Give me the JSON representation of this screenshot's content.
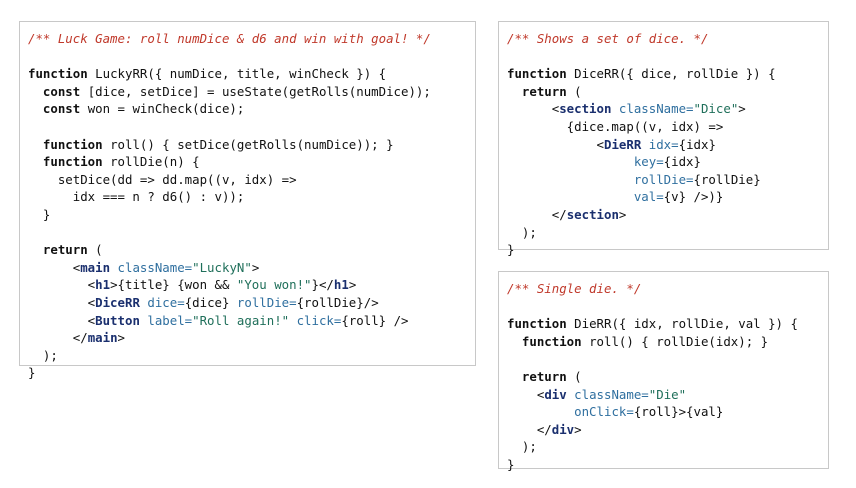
{
  "colors": {
    "comment": "#c0392b",
    "tag": "#1a2f6e",
    "attribute": "#2f6f9f",
    "string": "#1f6f5a",
    "text": "#111111",
    "border": "#c8c8c8"
  },
  "panels": [
    {
      "id": "lucky",
      "lines": [
        [
          [
            "cm",
            "/** Luck Game: roll numDice & d6 and win with goal! */"
          ]
        ],
        [],
        [
          [
            "kw",
            "function"
          ],
          [
            "pl",
            " LuckyRR({ numDice, title, winCheck }) {"
          ]
        ],
        [
          [
            "pl",
            "  "
          ],
          [
            "kw",
            "const"
          ],
          [
            "pl",
            " [dice, setDice] = useState(getRolls(numDice));"
          ]
        ],
        [
          [
            "pl",
            "  "
          ],
          [
            "kw",
            "const"
          ],
          [
            "pl",
            " won = winCheck(dice);"
          ]
        ],
        [],
        [
          [
            "pl",
            "  "
          ],
          [
            "kw",
            "function"
          ],
          [
            "pl",
            " roll() { setDice(getRolls(numDice)); }"
          ]
        ],
        [
          [
            "pl",
            "  "
          ],
          [
            "kw",
            "function"
          ],
          [
            "pl",
            " rollDie(n) {"
          ]
        ],
        [
          [
            "pl",
            "    setDice(dd => dd.map((v, idx) =>"
          ]
        ],
        [
          [
            "pl",
            "      idx === n ? d6() : v));"
          ]
        ],
        [
          [
            "pl",
            "  }"
          ]
        ],
        [],
        [
          [
            "pl",
            "  "
          ],
          [
            "kw",
            "return"
          ],
          [
            "pl",
            " ("
          ]
        ],
        [
          [
            "pl",
            "      <"
          ],
          [
            "tag",
            "main"
          ],
          [
            "pl",
            " "
          ],
          [
            "attr",
            "className="
          ],
          [
            "str",
            "\"LuckyN\""
          ],
          [
            "pl",
            ">"
          ]
        ],
        [
          [
            "pl",
            "        <"
          ],
          [
            "tag",
            "h1"
          ],
          [
            "pl",
            ">{title} {won && "
          ],
          [
            "str",
            "\"You won!\""
          ],
          [
            "pl",
            "}</"
          ],
          [
            "tag",
            "h1"
          ],
          [
            "pl",
            ">"
          ]
        ],
        [
          [
            "pl",
            "        <"
          ],
          [
            "tag",
            "DiceRR"
          ],
          [
            "pl",
            " "
          ],
          [
            "attr",
            "dice="
          ],
          [
            "pl",
            "{dice} "
          ],
          [
            "attr",
            "rollDie="
          ],
          [
            "pl",
            "{rollDie}/>"
          ]
        ],
        [
          [
            "pl",
            "        <"
          ],
          [
            "tag",
            "Button"
          ],
          [
            "pl",
            " "
          ],
          [
            "attr",
            "label="
          ],
          [
            "str",
            "\"Roll again!\""
          ],
          [
            "pl",
            " "
          ],
          [
            "attr",
            "click="
          ],
          [
            "pl",
            "{roll} />"
          ]
        ],
        [
          [
            "pl",
            "      </"
          ],
          [
            "tag",
            "main"
          ],
          [
            "pl",
            ">"
          ]
        ],
        [
          [
            "pl",
            "  );"
          ]
        ],
        [
          [
            "pl",
            "}"
          ]
        ]
      ]
    },
    {
      "id": "dice",
      "lines": [
        [
          [
            "cm",
            "/** Shows a set of dice. */"
          ]
        ],
        [],
        [
          [
            "kw",
            "function"
          ],
          [
            "pl",
            " DiceRR({ dice, rollDie }) {"
          ]
        ],
        [
          [
            "pl",
            "  "
          ],
          [
            "kw",
            "return"
          ],
          [
            "pl",
            " ("
          ]
        ],
        [
          [
            "pl",
            "      <"
          ],
          [
            "tag",
            "section"
          ],
          [
            "pl",
            " "
          ],
          [
            "attr",
            "className="
          ],
          [
            "str",
            "\"Dice\""
          ],
          [
            "pl",
            ">"
          ]
        ],
        [
          [
            "pl",
            "        {dice.map((v, idx) =>"
          ]
        ],
        [
          [
            "pl",
            "            <"
          ],
          [
            "tag",
            "DieRR"
          ],
          [
            "pl",
            " "
          ],
          [
            "attr",
            "idx="
          ],
          [
            "pl",
            "{idx}"
          ]
        ],
        [
          [
            "pl",
            "                 "
          ],
          [
            "attr",
            "key="
          ],
          [
            "pl",
            "{idx}"
          ]
        ],
        [
          [
            "pl",
            "                 "
          ],
          [
            "attr",
            "rollDie="
          ],
          [
            "pl",
            "{rollDie}"
          ]
        ],
        [
          [
            "pl",
            "                 "
          ],
          [
            "attr",
            "val="
          ],
          [
            "pl",
            "{v} />)}"
          ]
        ],
        [
          [
            "pl",
            "      </"
          ],
          [
            "tag",
            "section"
          ],
          [
            "pl",
            ">"
          ]
        ],
        [
          [
            "pl",
            "  );"
          ]
        ],
        [
          [
            "pl",
            "}"
          ]
        ]
      ]
    },
    {
      "id": "die",
      "lines": [
        [
          [
            "cm",
            "/** Single die. */"
          ]
        ],
        [],
        [
          [
            "kw",
            "function"
          ],
          [
            "pl",
            " DieRR({ idx, rollDie, val }) {"
          ]
        ],
        [
          [
            "pl",
            "  "
          ],
          [
            "kw",
            "function"
          ],
          [
            "pl",
            " roll() { rollDie(idx); }"
          ]
        ],
        [],
        [
          [
            "pl",
            "  "
          ],
          [
            "kw",
            "return"
          ],
          [
            "pl",
            " ("
          ]
        ],
        [
          [
            "pl",
            "    <"
          ],
          [
            "tag",
            "div"
          ],
          [
            "pl",
            " "
          ],
          [
            "attr",
            "className="
          ],
          [
            "str",
            "\"Die\""
          ]
        ],
        [
          [
            "pl",
            "         "
          ],
          [
            "attr",
            "onClick="
          ],
          [
            "pl",
            "{roll}>{val}"
          ]
        ],
        [
          [
            "pl",
            "    </"
          ],
          [
            "tag",
            "div"
          ],
          [
            "pl",
            ">"
          ]
        ],
        [
          [
            "pl",
            "  );"
          ]
        ],
        [
          [
            "pl",
            "}"
          ]
        ]
      ]
    }
  ]
}
